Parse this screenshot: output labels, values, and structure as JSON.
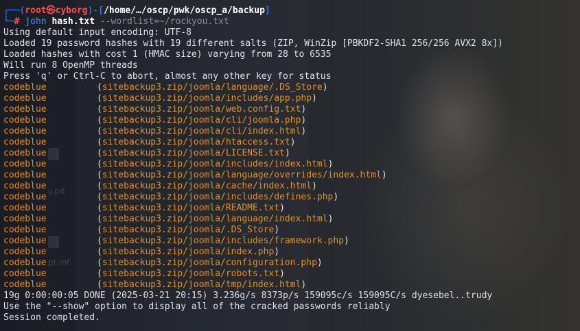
{
  "prompt": {
    "user": "root",
    "skull": "㉿",
    "host": "cyborg",
    "cwd": "/home/…/oscp/pwk/oscp_a/backup",
    "symbol": "#",
    "command": "john",
    "arg_file": "hash.txt",
    "arg_option": "--wordlist=~/rockyou.txt"
  },
  "output_header": [
    "Using default input encoding: UTF-8",
    "Loaded 19 password hashes with 19 different salts (ZIP, WinZip [PBKDF2-SHA1 256/256 AVX2 8x])",
    "Loaded hashes with cost 1 (HMAC size) varying from 28 to 6535",
    "Will run 8 OpenMP threads",
    "Press 'q' or Ctrl-C to abort, almost any other key for status"
  ],
  "cracked": [
    {
      "password": "codeblue",
      "file": "sitebackup3.zip/joomla/language/.DS_Store"
    },
    {
      "password": "codeblue",
      "file": "sitebackup3.zip/joomla/includes/app.php"
    },
    {
      "password": "codeblue",
      "file": "sitebackup3.zip/joomla/web.config.txt"
    },
    {
      "password": "codeblue",
      "file": "sitebackup3.zip/joomla/cli/joomla.php"
    },
    {
      "password": "codeblue",
      "file": "sitebackup3.zip/joomla/cli/index.html"
    },
    {
      "password": "codeblue",
      "file": "sitebackup3.zip/joomla/htaccess.txt"
    },
    {
      "password": "codeblue",
      "file": "sitebackup3.zip/joomla/LICENSE.txt"
    },
    {
      "password": "codeblue",
      "file": "sitebackup3.zip/joomla/includes/index.html"
    },
    {
      "password": "codeblue",
      "file": "sitebackup3.zip/joomla/language/overrides/index.html"
    },
    {
      "password": "codeblue",
      "file": "sitebackup3.zip/joomla/cache/index.html"
    },
    {
      "password": "codeblue",
      "file": "sitebackup3.zip/joomla/includes/defines.php"
    },
    {
      "password": "codeblue",
      "file": "sitebackup3.zip/joomla/README.txt"
    },
    {
      "password": "codeblue",
      "file": "sitebackup3.zip/joomla/language/index.html"
    },
    {
      "password": "codeblue",
      "file": "sitebackup3.zip/joomla/.DS_Store"
    },
    {
      "password": "codeblue",
      "file": "sitebackup3.zip/joomla/includes/framework.php"
    },
    {
      "password": "codeblue",
      "file": "sitebackup3.zip/joomla/index.php"
    },
    {
      "password": "codeblue",
      "file": "sitebackup3.zip/joomla/configuration.php"
    },
    {
      "password": "codeblue",
      "file": "sitebackup3.zip/joomla/robots.txt"
    },
    {
      "password": "codeblue",
      "file": "sitebackup3.zip/joomla/tmp/index.html"
    }
  ],
  "output_footer": [
    "19g 0:00:00:05 DONE (2025-03-21 20:15) 3.236g/s 8373p/s 159095c/s 159095C/s dyesebel..trudy",
    "Use the \"--show\" option to display all of the cracked passwords reliably",
    "Session completed."
  ],
  "desktop": {
    "icon_labels": [
      "y.pd",
      "pt.inf"
    ]
  },
  "colors": {
    "background": "#1c1f25",
    "prompt_frame": "#3f8cff",
    "user_host": "#ff4f52",
    "command": "#4d8ef0",
    "password": "#e0922a",
    "text": "#dfe2e7"
  }
}
